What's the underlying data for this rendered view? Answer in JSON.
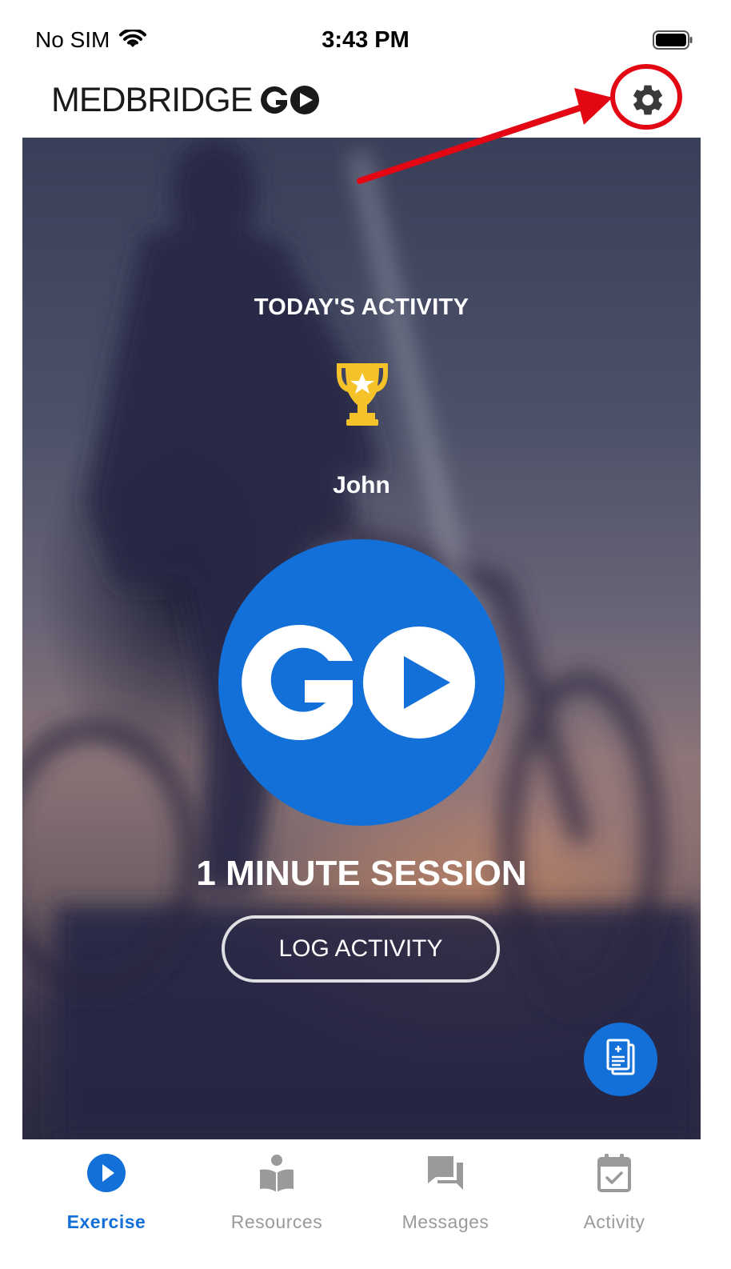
{
  "status_bar": {
    "carrier": "No SIM",
    "time": "3:43 PM"
  },
  "header": {
    "logo_text": "MEDBRIDGE",
    "logo_go": "GO",
    "settings_icon": "gear-icon"
  },
  "hero": {
    "activity_title": "TODAY'S ACTIVITY",
    "trophy_icon": "trophy-icon",
    "user_name": "John",
    "go_button_text": "GO",
    "session_label": "1 MINUTE SESSION",
    "log_activity_label": "LOG ACTIVITY",
    "fab_icon": "document-add-icon"
  },
  "annotation": {
    "color": "#e30613",
    "target": "settings gear"
  },
  "tabs": [
    {
      "label": "Exercise",
      "icon": "play-circle-icon",
      "active": true
    },
    {
      "label": "Resources",
      "icon": "reader-book-icon",
      "active": false
    },
    {
      "label": "Messages",
      "icon": "chat-bubbles-icon",
      "active": false
    },
    {
      "label": "Activity",
      "icon": "calendar-check-icon",
      "active": false
    }
  ],
  "colors": {
    "accent": "#1270d8",
    "inactive": "#9a9a9a",
    "trophy": "#f6c22a",
    "annotation": "#e30613"
  }
}
